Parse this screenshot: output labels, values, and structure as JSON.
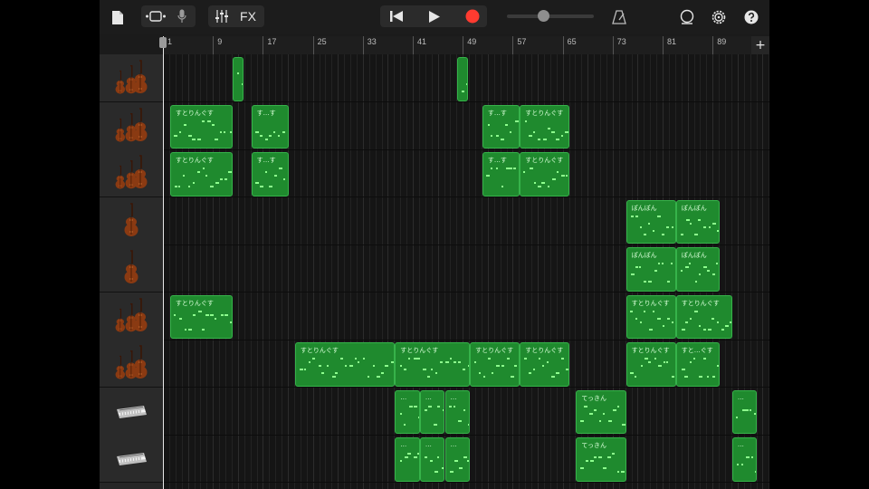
{
  "toolbar": {
    "fx_label": "FX",
    "colors": {
      "record": "#ff3b30",
      "icon": "#e6e6e6"
    }
  },
  "ruler": {
    "markers": [
      "9",
      "17",
      "25",
      "33",
      "41",
      "49",
      "57",
      "65",
      "73",
      "81",
      "89"
    ],
    "start_marker": "1",
    "add_label": "+"
  },
  "tracks": [
    {
      "instrument": "strings-ensemble-icon"
    },
    {
      "instrument": "strings-ensemble-icon"
    },
    {
      "instrument": "strings-ensemble-icon"
    },
    {
      "instrument": "cello-icon"
    },
    {
      "instrument": "cello-icon"
    },
    {
      "instrument": "strings-ensemble-icon"
    },
    {
      "instrument": "strings-ensemble-icon"
    },
    {
      "instrument": "keyboard-icon"
    },
    {
      "instrument": "keyboard-icon"
    }
  ],
  "regions": [
    {
      "track": 0,
      "start": 12,
      "end": 13,
      "name": ""
    },
    {
      "track": 0,
      "start": 48,
      "end": 49,
      "name": ""
    },
    {
      "track": 1,
      "start": 2,
      "end": 12,
      "name": "すとりんぐす"
    },
    {
      "track": 1,
      "start": 15,
      "end": 21,
      "name": "す…す"
    },
    {
      "track": 1,
      "start": 52,
      "end": 58,
      "name": "す…す"
    },
    {
      "track": 1,
      "start": 58,
      "end": 66,
      "name": "すとりんぐす"
    },
    {
      "track": 2,
      "start": 2,
      "end": 12,
      "name": "すとりんぐす"
    },
    {
      "track": 2,
      "start": 15,
      "end": 21,
      "name": "す…す"
    },
    {
      "track": 2,
      "start": 52,
      "end": 58,
      "name": "す…す"
    },
    {
      "track": 2,
      "start": 58,
      "end": 66,
      "name": "すとりんぐす"
    },
    {
      "track": 3,
      "start": 75,
      "end": 83,
      "name": "ぽんぽん"
    },
    {
      "track": 3,
      "start": 83,
      "end": 90,
      "name": "ぽんぽん"
    },
    {
      "track": 4,
      "start": 75,
      "end": 83,
      "name": "ぽんぽん"
    },
    {
      "track": 4,
      "start": 83,
      "end": 90,
      "name": "ぽんぽん"
    },
    {
      "track": 5,
      "start": 2,
      "end": 12,
      "name": "すとりんぐす"
    },
    {
      "track": 5,
      "start": 75,
      "end": 83,
      "name": "すとりんぐす"
    },
    {
      "track": 5,
      "start": 83,
      "end": 92,
      "name": "すとりんぐす"
    },
    {
      "track": 6,
      "start": 22,
      "end": 38,
      "name": "すとりんぐす"
    },
    {
      "track": 6,
      "start": 38,
      "end": 50,
      "name": "すとりんぐす"
    },
    {
      "track": 6,
      "start": 50,
      "end": 58,
      "name": "すとりんぐす"
    },
    {
      "track": 6,
      "start": 58,
      "end": 66,
      "name": "すとりんぐす"
    },
    {
      "track": 6,
      "start": 75,
      "end": 83,
      "name": "すとりんぐす"
    },
    {
      "track": 6,
      "start": 83,
      "end": 90,
      "name": "すと…ぐす"
    },
    {
      "track": 7,
      "start": 38,
      "end": 42,
      "name": "…"
    },
    {
      "track": 7,
      "start": 42,
      "end": 46,
      "name": "…"
    },
    {
      "track": 7,
      "start": 46,
      "end": 50,
      "name": "…"
    },
    {
      "track": 7,
      "start": 67,
      "end": 75,
      "name": "てっきん"
    },
    {
      "track": 7,
      "start": 92,
      "end": 96,
      "name": "…"
    },
    {
      "track": 8,
      "start": 38,
      "end": 42,
      "name": "…"
    },
    {
      "track": 8,
      "start": 42,
      "end": 46,
      "name": "…"
    },
    {
      "track": 8,
      "start": 46,
      "end": 50,
      "name": "…"
    },
    {
      "track": 8,
      "start": 67,
      "end": 75,
      "name": "てっきん"
    },
    {
      "track": 8,
      "start": 92,
      "end": 96,
      "name": "…"
    }
  ]
}
